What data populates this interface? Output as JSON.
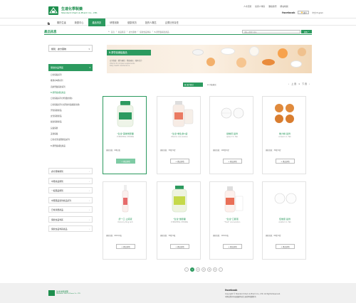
{
  "brand": {
    "name_zh": "生達化學製藥",
    "name_en": "Standard Chem & Pharm Co., LTD."
  },
  "top_links": [
    "人才招募",
    "投資人專區",
    "聯絡我們",
    "網站地圖"
  ],
  "facebook": {
    "label": "facebook",
    "like": "讚 0",
    "lang": "中文 English"
  },
  "nav": {
    "items": [
      "關於生達",
      "新聞中心",
      "產品資訊",
      "研發創新",
      "健康資訊",
      "投資人專區",
      "企業社會責任"
    ],
    "active_index": 2
  },
  "crumb": {
    "title": "產品訊息",
    "path": [
      "首頁",
      "產品資訊",
      "處方藥物",
      "保健食品專區",
      "B-群營養補給產品"
    ],
    "search_placeholder": "請輸入關鍵字搜尋",
    "search_button": "搜尋"
  },
  "sidebar": {
    "select_label": "類別：處方藥物",
    "header": "保健食品專區",
    "subitems": [
      "日常保養系列",
      "維他命B群系列",
      "高齡營養保健系列",
      "B-群營養補給產品",
      "日常保養系列(沖泡飲用類)",
      "日常保養系列(立即食用滋補養生類)",
      "男性保健產品",
      "女性保健產品",
      "婦幼保健產品",
      "兒童保健",
      "美容保養",
      "日常/居家護理產品系列",
      "B-群營養補給產品"
    ],
    "active_sub_index": 3,
    "main_items": [
      "處方藥物類別",
      "中藥產品類別",
      "一般藥品類別",
      "中藥藥品製劑產品系列",
      "日常消費產品",
      "保健食品專區",
      "保健食品專區產品"
    ]
  },
  "banner": {
    "title": "B-群營養補給產品",
    "sub": "日常保養｜體力補給｜營養補充｜精神活力",
    "en_line1": "Vitamin B complex supplements",
    "en_line2": "Daily health maintenance"
  },
  "filters": {
    "view_grid": "圖片模式",
    "view_list": "列表模式"
  },
  "pager_top": [
    "‹",
    "上 頁",
    "1",
    "下 頁",
    "›"
  ],
  "products": [
    {
      "name": "\"生達\"美維樂膠囊",
      "en": "CYPROHEAL STRONG",
      "spec": "規格包裝：60粒/盒",
      "button": "+ 產品詳情",
      "green": true
    },
    {
      "name": "\"生達\"維生素C錠",
      "en": "Vitamin oral solution",
      "spec": "規格包裝：30錠/1錠",
      "button": "+ 產品詳情",
      "green": false
    },
    {
      "name": "健維鈣 錠劑",
      "en": "Aplus T.C. Tab",
      "spec": "規格包裝：100錠/1錠",
      "button": "+ 產品詳情",
      "green": false
    },
    {
      "name": "維力精 錠劑",
      "en": "Aciwel C.C. Tab",
      "spec": "規格包裝：30錠/1錠",
      "button": "+ 產品詳情",
      "green": false
    },
    {
      "name": "舒一口 止痛液",
      "en": "Dolcerry Ding Anti",
      "spec": "規格包裝：60ml/1瓶",
      "button": "+ 產品詳情",
      "green": false
    },
    {
      "name": "\"生達\"優膠囊",
      "en": "CYPROHEAL STRONG",
      "spec": "規格包裝：30錠/1瓶",
      "button": "+ 產品詳情",
      "green": false
    },
    {
      "name": "\"生達\"口服液",
      "en": "\"Trust\" oral solution",
      "spec": "規格包裝：10ml/1瓶",
      "button": "+ 產品詳情",
      "green": false
    },
    {
      "name": "佳維康 錠劑",
      "en": "Acaltsil I.C. Tab",
      "spec": "規格包裝：60錠/1錠",
      "button": "+ 產品詳情",
      "green": false
    }
  ],
  "pagination": [
    "‹",
    "1",
    "2",
    "3",
    "4",
    "5",
    "›"
  ],
  "pagination_active": 1,
  "footer": {
    "logo_zh": "生達化學製藥",
    "logo_en": "Standard Chem & Pharm Co., LTD.",
    "fb": "facebook",
    "copy1": "Copyright © Standard Chem & Pharm Co., LTD. All Rights Reserved.",
    "copy2": "本網站所有內容版權均為生達化學製藥所有"
  },
  "colors": {
    "accent": "#2c9a5f",
    "brand": "#1e8f4e",
    "footer_bg": "#f0f0f0"
  }
}
